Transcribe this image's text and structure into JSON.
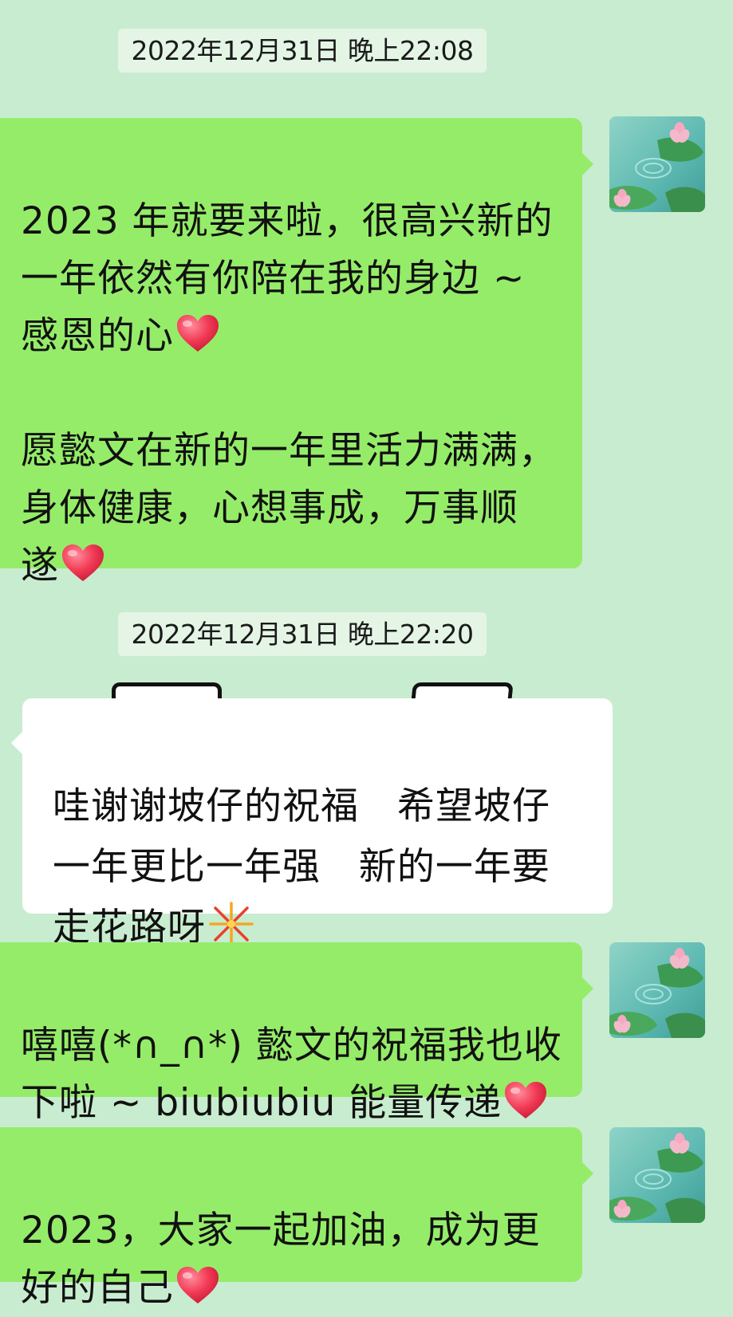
{
  "colors": {
    "background": "#c8eccf",
    "outgoing_bubble": "#95ec69",
    "incoming_bubble": "#ffffff",
    "timestamp_bg": "#e4f5e6"
  },
  "timestamps": [
    "2022年12月31日 晚上22:08",
    "2022年12月31日 晚上22:20"
  ],
  "messages": [
    {
      "side": "outgoing",
      "lines": [
        "2023 年就要来啦，很高兴新的",
        "一年依然有你陪在我的身边 ~",
        "感恩的心",
        "",
        "愿懿文在新的一年里活力满满，",
        "身体健康，心想事成，万事顺",
        "遂"
      ],
      "emoji": "heart"
    },
    {
      "side": "incoming",
      "lines": [
        "哇谢谢坡仔的祝福   希望坡仔",
        "一年更比一年强   新的一年要",
        "走花路呀"
      ],
      "emoji": "firework"
    },
    {
      "side": "outgoing",
      "lines": [
        "嘻嘻(*∩_∩*) 懿文的祝福我也收",
        "下啦 ~ biubiubiu 能量传递"
      ],
      "emoji": "heart"
    },
    {
      "side": "outgoing",
      "lines": [
        "2023，大家一起加油，成为更",
        "好的自己"
      ],
      "emoji": "heart"
    }
  ],
  "icons": {
    "avatar": "lotus-pond-avatar-icon",
    "heart": "red-heart-emoji-icon",
    "firework": "firework-emoji-icon"
  }
}
